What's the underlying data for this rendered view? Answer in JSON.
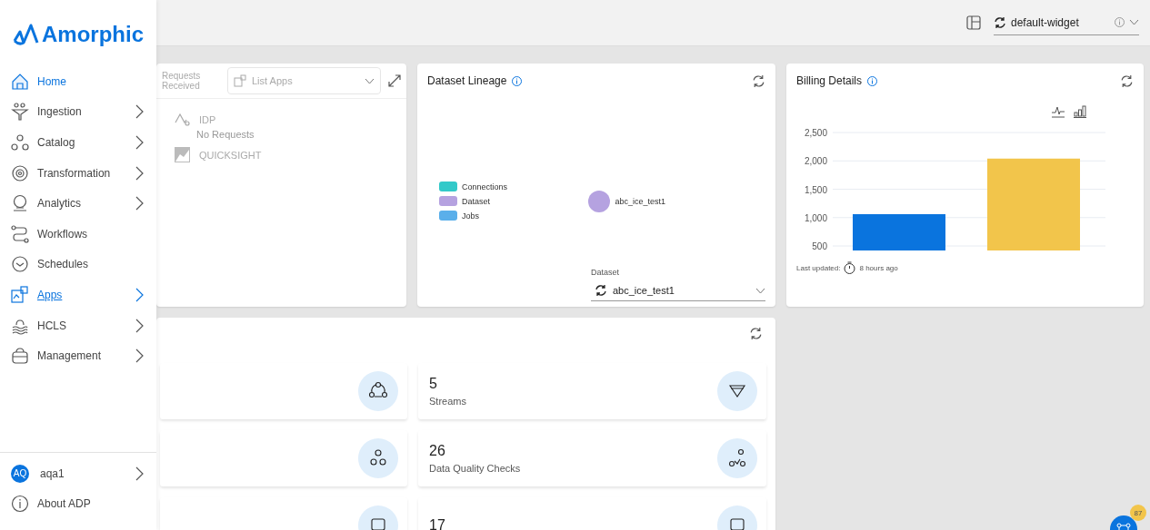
{
  "brand": {
    "name": "Amorphic"
  },
  "sidebar": {
    "items": [
      {
        "label": "Home",
        "selected": true,
        "hover": false,
        "expandable": false
      },
      {
        "label": "Ingestion",
        "selected": false,
        "hover": false,
        "expandable": true
      },
      {
        "label": "Catalog",
        "selected": false,
        "hover": false,
        "expandable": true
      },
      {
        "label": "Transformation",
        "selected": false,
        "hover": false,
        "expandable": true
      },
      {
        "label": "Analytics",
        "selected": false,
        "hover": false,
        "expandable": true
      },
      {
        "label": "Workflows",
        "selected": false,
        "hover": false,
        "expandable": false
      },
      {
        "label": "Schedules",
        "selected": false,
        "hover": false,
        "expandable": false
      },
      {
        "label": "Apps",
        "selected": false,
        "hover": true,
        "expandable": true
      },
      {
        "label": "HCLS",
        "selected": false,
        "hover": false,
        "expandable": true
      },
      {
        "label": "Management",
        "selected": false,
        "hover": false,
        "expandable": true
      }
    ],
    "user": {
      "initials": "AQ",
      "name": "aqa1"
    },
    "about": "About ADP"
  },
  "topbar": {
    "widget_select": {
      "value": "default-widget"
    }
  },
  "apps_card": {
    "caption": "Requests Received",
    "select": {
      "value": "List Apps"
    },
    "apps": [
      {
        "label": "IDP"
      },
      {
        "label": "QUICKSIGHT"
      }
    ],
    "empty": "No Requests"
  },
  "lineage_card": {
    "title": "Dataset Lineage",
    "legend": [
      {
        "label": "Connections",
        "color": "#33c9c9"
      },
      {
        "label": "Dataset",
        "color": "#b5a2e0"
      },
      {
        "label": "Jobs",
        "color": "#5aafea"
      }
    ],
    "node": {
      "label": "abc_ice_test1",
      "color": "#b5a2e0"
    },
    "dataset_field": {
      "label": "Dataset",
      "value": "abc_ice_test1"
    }
  },
  "billing_card": {
    "title": "Billing Details",
    "chart_data": {
      "type": "bar",
      "yticks": [
        {
          "value": 500,
          "label": "500"
        },
        {
          "value": 1000,
          "label": "1,000"
        },
        {
          "value": 1500,
          "label": "1,500"
        },
        {
          "value": 2000,
          "label": "2,000"
        },
        {
          "value": 2500,
          "label": "2,500"
        }
      ],
      "ylim": [
        420,
        2500
      ],
      "grid": true,
      "series": [
        {
          "color": "#0a74de",
          "values": [
            1060
          ]
        },
        {
          "color": "#f2c54b",
          "values": [
            2040
          ]
        }
      ]
    },
    "last_updated_label": "Last updated:",
    "last_updated": "8 hours ago"
  },
  "stats_card": {
    "tiles": [
      {
        "kind": "icon"
      },
      {
        "kind": "stat",
        "number": "5",
        "label": "Streams"
      },
      {
        "kind": "icon"
      },
      {
        "kind": "stat",
        "number": "26",
        "label": "Data Quality Checks"
      },
      {
        "kind": "icon"
      },
      {
        "kind": "stat",
        "number": "17"
      }
    ]
  },
  "fab": {
    "badge": "87"
  }
}
